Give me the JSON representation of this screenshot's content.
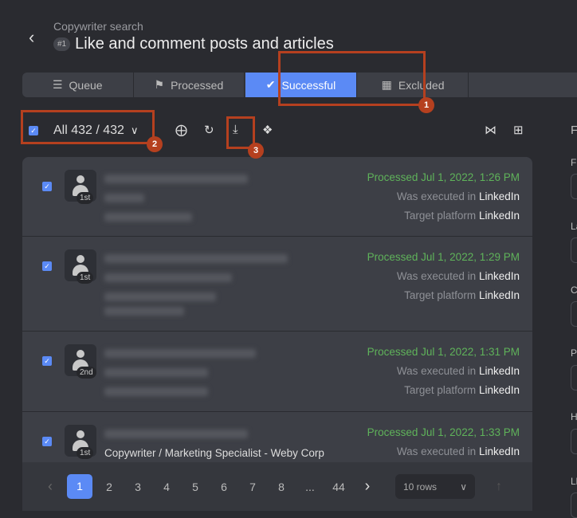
{
  "header": {
    "breadcrumb": "Copywriter search",
    "badge": "#1",
    "title": "Like and comment posts and articles"
  },
  "tabs": [
    {
      "label": "Queue",
      "icon": "queue-icon"
    },
    {
      "label": "Processed",
      "icon": "flag-icon"
    },
    {
      "label": "Successful",
      "icon": "check-icon",
      "active": true
    },
    {
      "label": "Excluded",
      "icon": "excluded-icon"
    }
  ],
  "toolbar": {
    "select_label": "All 432 / 432"
  },
  "rows": [
    {
      "degree": "1st",
      "processed": "Processed Jul 1, 2022, 1:26 PM",
      "exec_label": "Was executed in",
      "exec_value": "LinkedIn",
      "target_label": "Target platform",
      "target_value": "LinkedIn"
    },
    {
      "degree": "1st",
      "processed": "Processed Jul 1, 2022, 1:29 PM",
      "exec_label": "Was executed in",
      "exec_value": "LinkedIn",
      "target_label": "Target platform",
      "target_value": "LinkedIn"
    },
    {
      "degree": "2nd",
      "processed": "Processed Jul 1, 2022, 1:31 PM",
      "exec_label": "Was executed in",
      "exec_value": "LinkedIn",
      "target_label": "Target platform",
      "target_value": "LinkedIn"
    },
    {
      "degree": "1st",
      "job": "Copywriter / Marketing Specialist - Weby Corp",
      "processed": "Processed Jul 1, 2022, 1:33 PM",
      "exec_label": "Was executed in",
      "exec_value": "LinkedIn"
    }
  ],
  "pagination": {
    "pages": [
      "1",
      "2",
      "3",
      "4",
      "5",
      "6",
      "7",
      "8",
      "...",
      "44"
    ],
    "current": "1",
    "rows_label": "10 rows"
  },
  "right_panel": {
    "heading": "F",
    "labels": [
      "F",
      "La",
      "C",
      "P",
      "H",
      "Ll"
    ]
  },
  "annotations": [
    "1",
    "2",
    "3"
  ],
  "colors": {
    "accent": "#5b8af5",
    "success": "#5fb35a",
    "annotation": "#b5401f"
  }
}
